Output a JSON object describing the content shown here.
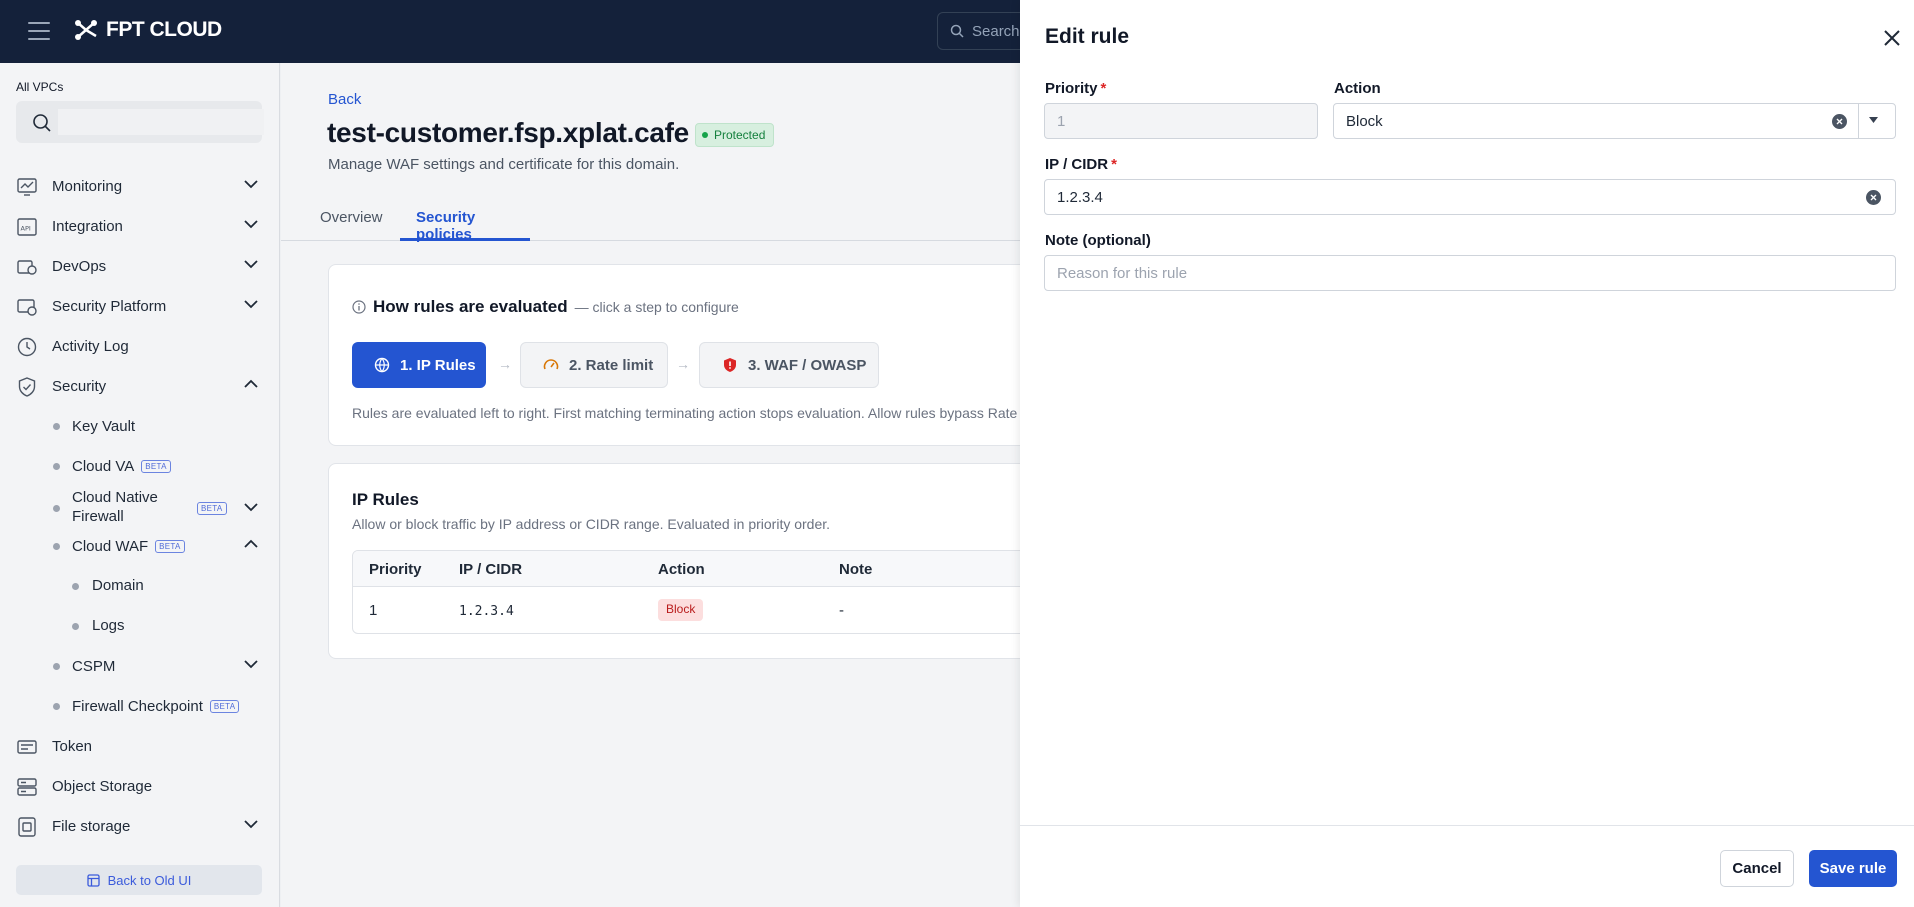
{
  "header": {
    "logo_text": "FPT CLOUD",
    "search_placeholder": "Search"
  },
  "sidebar": {
    "vpc_label": "All VPCs",
    "items": [
      {
        "label": "Monitoring",
        "icon": "monitoring-icon",
        "expanded": false
      },
      {
        "label": "Integration",
        "icon": "api-icon",
        "expanded": false
      },
      {
        "label": "DevOps",
        "icon": "devops-icon",
        "expanded": false
      },
      {
        "label": "Security Platform",
        "icon": "shield-gear-icon",
        "expanded": false
      },
      {
        "label": "Activity Log",
        "icon": "clock-icon"
      },
      {
        "label": "Security",
        "icon": "shield-icon",
        "expanded": true
      },
      {
        "label": "Token",
        "icon": "token-icon"
      },
      {
        "label": "Object Storage",
        "icon": "storage-icon"
      },
      {
        "label": "File storage",
        "icon": "file-storage-icon",
        "expanded": false
      }
    ],
    "security_children": {
      "key_vault": "Key Vault",
      "cloud_va": "Cloud VA",
      "cloud_native_firewall": "Cloud Native Firewall",
      "cloud_waf": "Cloud WAF",
      "domain": "Domain",
      "logs": "Logs",
      "cspm": "CSPM",
      "firewall_checkpoint": "Firewall Checkpoint"
    },
    "beta_label": "BETA",
    "back_to_old": "Back to Old UI"
  },
  "main": {
    "back": "Back",
    "title": "test-customer.fsp.xplat.cafe",
    "status_badge": "Protected",
    "subtitle": "Manage WAF settings and certificate for this domain.",
    "tabs": [
      "Overview",
      "Security policies"
    ],
    "active_tab": "Security policies",
    "evaluation": {
      "heading": "How rules are evaluated",
      "hint": "— click a step to configure",
      "steps": [
        "1. IP Rules",
        "2. Rate limit",
        "3. WAF / OWASP"
      ],
      "note": "Rules are evaluated left to right. First matching terminating action stops evaluation. Allow rules bypass Rate L"
    },
    "ip_rules": {
      "title": "IP Rules",
      "description": "Allow or block traffic by IP address or CIDR range. Evaluated in priority order.",
      "columns": [
        "Priority",
        "IP / CIDR",
        "Action",
        "Note"
      ],
      "rows": [
        {
          "priority": "1",
          "ip": "1.2.3.4",
          "action": "Block",
          "note": "-"
        }
      ]
    }
  },
  "drawer": {
    "title": "Edit rule",
    "priority_label": "Priority",
    "priority_value": "1",
    "action_label": "Action",
    "action_value": "Block",
    "ip_label": "IP / CIDR",
    "ip_value": "1.2.3.4",
    "note_label": "Note (optional)",
    "note_placeholder": "Reason for this rule",
    "required_mark": "*",
    "cancel": "Cancel",
    "save": "Save rule"
  },
  "colors": {
    "brand_blue": "#2455d1",
    "topbar": "#14213a",
    "block_red": "#b91c1c",
    "protected_green": "#15803d"
  }
}
